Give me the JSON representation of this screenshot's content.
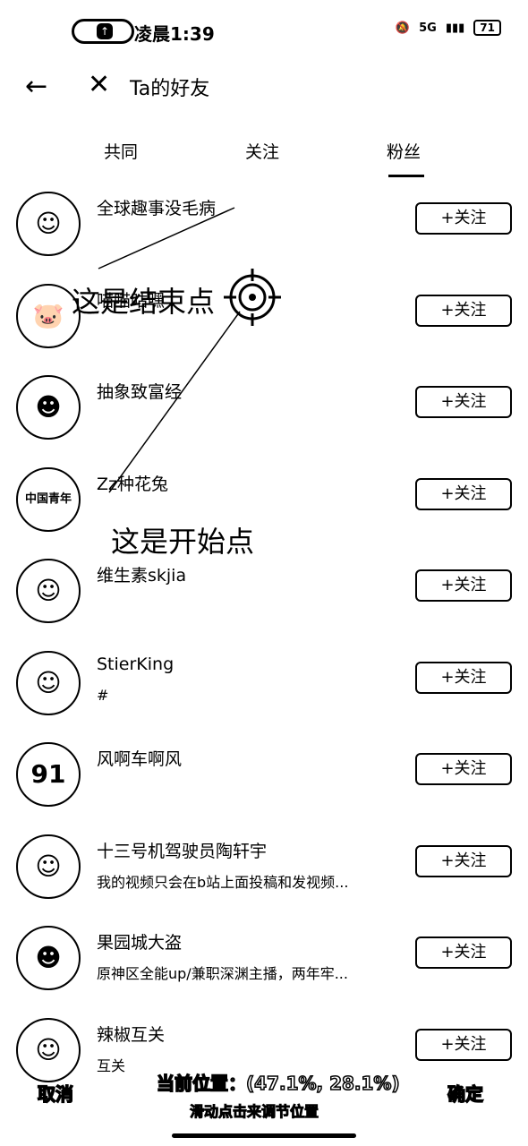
{
  "status": {
    "time": "凌晨1:39",
    "network": "5G",
    "battery": "71"
  },
  "nav": {
    "title": "Ta的好友"
  },
  "tabs": [
    {
      "label": "共同"
    },
    {
      "label": "关注"
    },
    {
      "label": "粉丝"
    }
  ],
  "active_tab": "粉丝",
  "users": [
    {
      "name": "全球趣事没毛病",
      "desc": "",
      "button": "+关注",
      "avatar": "☺"
    },
    {
      "name": "喵喵咕嘿",
      "desc": "",
      "button": "+关注",
      "avatar": "🐷"
    },
    {
      "name": "抽象致富经",
      "desc": "",
      "button": "+关注",
      "avatar": "☻"
    },
    {
      "name": "Zz种花兔",
      "desc": "",
      "button": "+关注",
      "avatar": "中国青年"
    },
    {
      "name": "维生素skjia",
      "desc": "",
      "button": "+关注",
      "avatar": "☺"
    },
    {
      "name": "StierKing",
      "desc": "#",
      "button": "+关注",
      "avatar": "☺"
    },
    {
      "name": "风啊车啊风",
      "desc": "",
      "button": "+关注",
      "avatar": "91"
    },
    {
      "name": "十三号机驾驶员陶轩宇",
      "desc": "我的视频只会在b站上面投稿和发视频...",
      "button": "+关注",
      "avatar": "☺"
    },
    {
      "name": "果园城大盗",
      "desc": "原神区全能up/兼职深渊主播，两年牢...",
      "button": "+关注",
      "avatar": "☻"
    },
    {
      "name": "辣椒互关",
      "desc": "互关",
      "button": "+关注",
      "avatar": "☺"
    }
  ],
  "overlay": {
    "end_label": "这是结束点",
    "start_label": "这是开始点"
  },
  "bottom": {
    "cancel": "取消",
    "position": "当前位置：(47.1%, 28.1%)",
    "hint": "滑动点击来调节位置",
    "confirm": "确定"
  }
}
